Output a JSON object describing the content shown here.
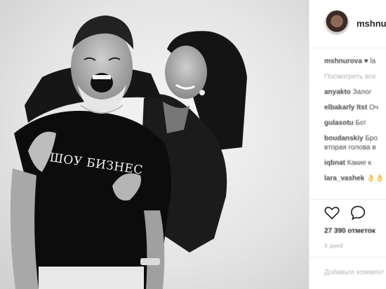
{
  "photo": {
    "shirt_text": "ШОУ БИЗНЕС"
  },
  "post": {
    "username": "mshnurova",
    "icons": {
      "avatar": "profile-avatar",
      "like": "heart-icon",
      "comment": "comment-icon"
    },
    "caption": {
      "user": "mshnurova",
      "text": "♥ la"
    },
    "view_all": "Посмотреть все",
    "comments": [
      {
        "user": "anyakto",
        "text": "Залог"
      },
      {
        "user": "elbakarly ltst",
        "text": "Оч"
      },
      {
        "user": "gulasotu",
        "text": "Бо!"
      },
      {
        "user": "boudanskiy",
        "text": "Бро"
      },
      {
        "user": "",
        "text": "вторая голова в"
      },
      {
        "user": "iqbnat",
        "text": "Какие к"
      },
      {
        "user": "lara_vashek",
        "text": "👌👌"
      }
    ],
    "likes": "27 390 отметок",
    "time": "6 дней",
    "comment_placeholder": "Добавьте комментарий"
  }
}
